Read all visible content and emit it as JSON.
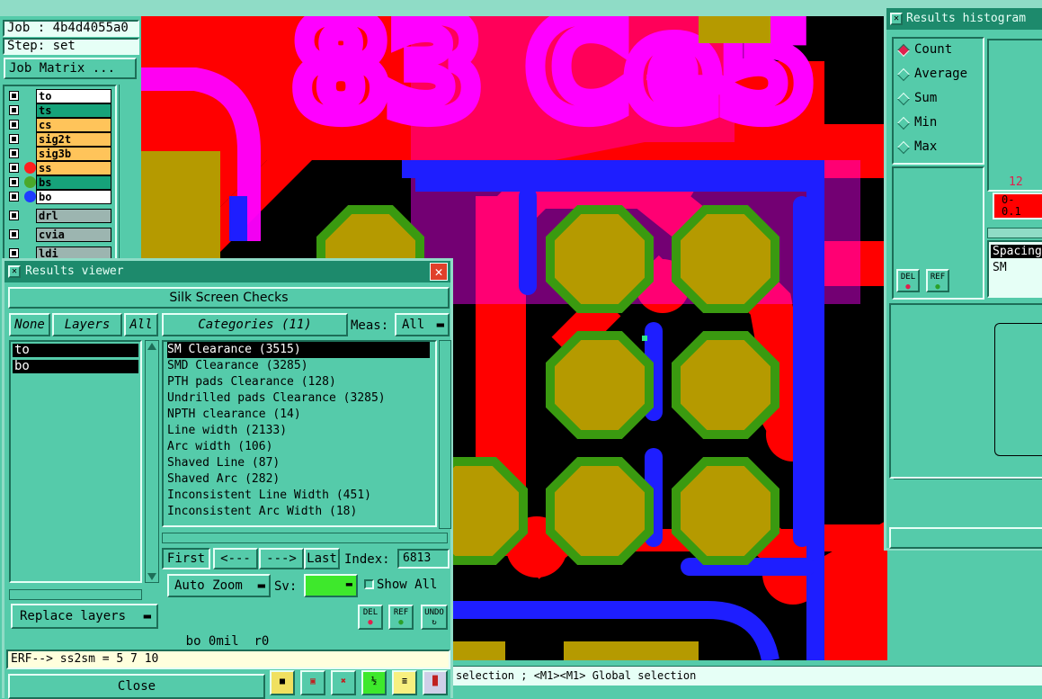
{
  "job_panel": {
    "job": "Job : 4b4d4055a0",
    "step": "Step: set",
    "job_matrix": "Job Matrix ..."
  },
  "layers": [
    {
      "name": "to",
      "color": "#ffffff",
      "dot": ""
    },
    {
      "name": "ts",
      "color": "#16a37a",
      "dot": ""
    },
    {
      "name": "cs",
      "color": "#ffc45a",
      "dot": ""
    },
    {
      "name": "sig2t",
      "color": "#ffc45a",
      "dot": ""
    },
    {
      "name": "sig3b",
      "color": "#ffc45a",
      "dot": ""
    },
    {
      "name": "ss",
      "color": "#ffc45a",
      "dot": "#ff1e1e"
    },
    {
      "name": "bs",
      "color": "#16a37a",
      "dot": "#4aa82a"
    },
    {
      "name": "bo",
      "color": "#ffffff",
      "dot": "#1e3cff"
    },
    {
      "name": "drl",
      "color": "#9cb5b0",
      "dot": ""
    },
    {
      "name": "cvia",
      "color": "#9cb5b0",
      "dot": ""
    },
    {
      "name": "ldi",
      "color": "#9cb5b0",
      "dot": ""
    }
  ],
  "results_viewer": {
    "title": "Results viewer",
    "header": "Silk Screen Checks",
    "none_label": "None",
    "layers_label": "Layers",
    "all_label": "All",
    "selected_layers": [
      "to",
      "bo"
    ],
    "categories_label": "Categories (11)",
    "meas_label": "Meas:",
    "meas_value": "All",
    "categories": [
      "SM Clearance (3515)",
      "SMD Clearance (3285)",
      "PTH pads Clearance (128)",
      "Undrilled pads Clearance (3285)",
      "NPTH clearance (14)",
      "Line width (2133)",
      "Arc width (106)",
      "Shaved Line (87)",
      "Shaved Arc (282)",
      "Inconsistent Line Width (451)",
      "Inconsistent Arc Width (18)"
    ],
    "first_label": "First",
    "prev_label": "<---",
    "next_label": "--->",
    "last_label": "Last",
    "index_label": "Index:",
    "index_value": "6813",
    "auto_zoom_label": "Auto Zoom",
    "sv_label": "Sv:",
    "show_all_label": "Show All",
    "replace_layers_label": "Replace layers",
    "del_label": "DEL",
    "ref_label": "REF",
    "undo_label": "UNDO",
    "status_line": "bo 0mil  r0",
    "erf_line": "ERF--> ss2sm = 5 7 10",
    "close_label": "Close"
  },
  "histogram": {
    "title": "Results histogram",
    "options": [
      "Count",
      "Average",
      "Sum",
      "Min",
      "Max"
    ],
    "selected": "Count",
    "bar_count": "12",
    "bin_label": "0-\n0.1",
    "list": [
      "Spacing",
      "SM"
    ],
    "del_label": "DEL",
    "ref_label": "REF"
  },
  "canvas_labels": {
    "silk_text": "83 Ce5"
  },
  "status_bar": "selection ; <M1><M1> Global selection",
  "colors": {
    "panel": "#55cbaa",
    "red": "#ff0000",
    "magenta": "#ff00ff",
    "blue": "#1e1eff",
    "pad": "#b59a00",
    "green": "#3a9a10"
  }
}
